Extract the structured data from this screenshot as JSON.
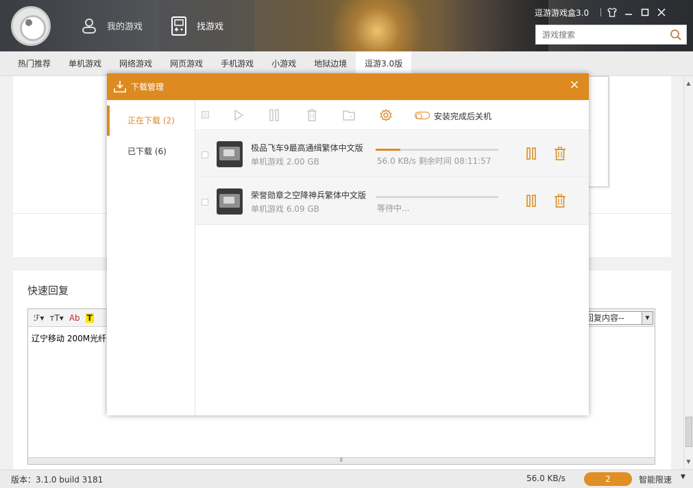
{
  "header": {
    "nav": {
      "my_games": "我的游戏",
      "find_games": "找游戏"
    },
    "app_title": "逗游游戏盒3.0",
    "search_placeholder": "游戏搜索"
  },
  "tabs": [
    "热门推荐",
    "单机游戏",
    "网络游戏",
    "网页游戏",
    "手机游戏",
    "小游戏",
    "地狱边境",
    "逗游3.0版"
  ],
  "active_tab": "逗游3.0版",
  "page": {
    "reply_title": "快速回复",
    "editor_text": "辽宁移动 200M光纤",
    "editor_select": "捷回复内容--",
    "toolbar": {
      "font": "ℱ▾",
      "size": "ᴛT▾",
      "color": "Ab",
      "highlight": "T"
    }
  },
  "dialog": {
    "title": "下载管理",
    "close": "×",
    "sidebar": [
      {
        "label": "正在下载 (2)",
        "active": true
      },
      {
        "label": "已下载 (6)",
        "active": false
      }
    ],
    "shutdown_label": "安装完成后关机",
    "downloads": [
      {
        "name": "极品飞车9最高通缉繁体中文版",
        "meta": "单机游戏  2.00 GB",
        "progress": 0.2,
        "status": "56.0 KB/s  剩余时间 08:11:57"
      },
      {
        "name": "荣誉勋章之空降神兵繁体中文版",
        "meta": "单机游戏  6.09 GB",
        "progress": 0.0,
        "status": "等待中..."
      }
    ]
  },
  "statusbar": {
    "version": "版本：3.1.0 build 3181",
    "speed": "56.0 KB/s",
    "badge": "2",
    "limit": "智能限速",
    "limit_arrow": "▼"
  },
  "colors": {
    "accent": "#dd8a21"
  }
}
